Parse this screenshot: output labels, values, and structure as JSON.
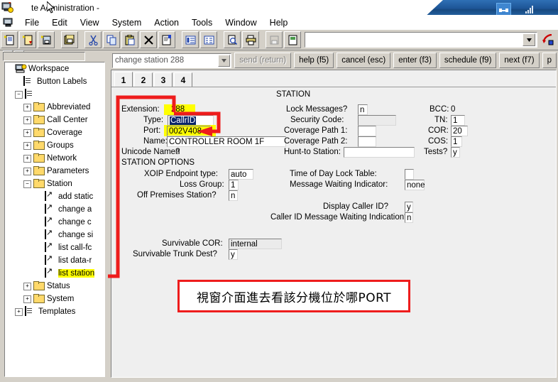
{
  "window": {
    "title": "te Administration -",
    "taskbar_icons": [
      "network-connect-icon",
      "signal-bars-icon"
    ]
  },
  "menubar": {
    "app_icon": "computer-icon",
    "items": [
      "File",
      "Edit",
      "View",
      "System",
      "Action",
      "Tools",
      "Window",
      "Help"
    ]
  },
  "toolbar": {
    "buttons": [
      "new-document-icon",
      "open-document-icon",
      "save-document-icon",
      "save-all-icon",
      "cut-icon",
      "copy-icon",
      "paste-icon",
      "delete-x-icon",
      "properties-icon",
      "list-view-icon",
      "detail-view-icon",
      "print-preview-icon",
      "print-icon",
      "save-disabled-icon",
      "report-icon"
    ],
    "address_value": "",
    "address_dropdown_icon": "chevron-down-icon",
    "go_icon": "go-arrow-icon"
  },
  "sidebar": {
    "scrollbar": "horizontal-scrollbar",
    "close_icon": "close-x-icon",
    "dropdown_icon": "chevron-down-icon",
    "tree": [
      {
        "label": "Workspace",
        "icon": "workspace-icon",
        "depth": 0,
        "toggle": "none",
        "highlight": false
      },
      {
        "label": "Button Labels",
        "icon": "book-icon",
        "depth": 1,
        "toggle": "none",
        "highlight": false
      },
      {
        "label": "",
        "icon": "book-icon",
        "depth": 1,
        "toggle": "minus",
        "highlight": false
      },
      {
        "label": "Abbreviated",
        "icon": "folder-icon",
        "depth": 2,
        "toggle": "plus",
        "highlight": false
      },
      {
        "label": "Call Center",
        "icon": "folder-icon",
        "depth": 2,
        "toggle": "plus",
        "highlight": false
      },
      {
        "label": "Coverage",
        "icon": "folder-icon",
        "depth": 2,
        "toggle": "plus",
        "highlight": false
      },
      {
        "label": "Groups",
        "icon": "folder-icon",
        "depth": 2,
        "toggle": "plus",
        "highlight": false
      },
      {
        "label": "Network",
        "icon": "folder-icon",
        "depth": 2,
        "toggle": "plus",
        "highlight": false
      },
      {
        "label": "Parameters",
        "icon": "folder-icon",
        "depth": 2,
        "toggle": "plus",
        "highlight": false
      },
      {
        "label": "Station",
        "icon": "folder-icon",
        "depth": 2,
        "toggle": "minus",
        "highlight": false
      },
      {
        "label": "add static",
        "icon": "shortcut-icon",
        "depth": 3,
        "toggle": "none",
        "highlight": false
      },
      {
        "label": "change a",
        "icon": "shortcut-icon",
        "depth": 3,
        "toggle": "none",
        "highlight": false
      },
      {
        "label": "change c",
        "icon": "shortcut-icon",
        "depth": 3,
        "toggle": "none",
        "highlight": false
      },
      {
        "label": "change si",
        "icon": "shortcut-icon",
        "depth": 3,
        "toggle": "none",
        "highlight": false
      },
      {
        "label": "list call-fc",
        "icon": "shortcut-icon",
        "depth": 3,
        "toggle": "none",
        "highlight": false
      },
      {
        "label": "list data-r",
        "icon": "shortcut-icon",
        "depth": 3,
        "toggle": "none",
        "highlight": false
      },
      {
        "label": "list station",
        "icon": "shortcut-icon",
        "depth": 3,
        "toggle": "none",
        "highlight": true
      },
      {
        "label": "Status",
        "icon": "folder-icon",
        "depth": 2,
        "toggle": "plus",
        "highlight": false
      },
      {
        "label": "System",
        "icon": "folder-icon",
        "depth": 2,
        "toggle": "plus",
        "highlight": false
      },
      {
        "label": "Templates",
        "icon": "book-icon",
        "depth": 1,
        "toggle": "plus",
        "highlight": false
      }
    ]
  },
  "command_bar": {
    "command_value": "change station 288",
    "dropdown_icon": "chevron-down-icon",
    "buttons": [
      {
        "label": "send (return)",
        "disabled": true
      },
      {
        "label": "help (f5)",
        "disabled": false
      },
      {
        "label": "cancel (esc)",
        "disabled": false
      },
      {
        "label": "enter (f3)",
        "disabled": false
      },
      {
        "label": "schedule (f9)",
        "disabled": false
      },
      {
        "label": "next (f7)",
        "disabled": false
      },
      {
        "label": "p",
        "disabled": false
      }
    ]
  },
  "form": {
    "tabs": [
      "1",
      "2",
      "3",
      "4"
    ],
    "active_tab": "1",
    "title": "STATION",
    "left_fields": [
      {
        "label": "Extension:",
        "value": "288",
        "style": "highlight"
      },
      {
        "label": "Type:",
        "value": "CallrID",
        "style": "selected"
      },
      {
        "label": "Port:",
        "value": "002V408",
        "style": "highlight"
      },
      {
        "label": "Name:",
        "value": "CONTROLLER ROOM 1F",
        "style": "input-wide"
      },
      {
        "label": "Unicode Name?",
        "value": "n",
        "style": "plain"
      }
    ],
    "right_fields": [
      {
        "label": "Lock Messages?",
        "value": "n",
        "style": "input-tiny"
      },
      {
        "label": "Security Code:",
        "value": "",
        "style": "input-gray"
      },
      {
        "label": "Coverage Path 1:",
        "value": "",
        "style": "input-small"
      },
      {
        "label": "Coverage Path 2:",
        "value": "",
        "style": "input-small"
      },
      {
        "label": "Hunt-to Station:",
        "value": "",
        "style": "input-wide2"
      }
    ],
    "far_right_fields": [
      {
        "label": "BCC:",
        "value": "0",
        "style": "plain"
      },
      {
        "label": "TN:",
        "value": "1",
        "style": "input-tiny"
      },
      {
        "label": "COR:",
        "value": "20",
        "style": "input-tiny"
      },
      {
        "label": "COS:",
        "value": "1",
        "style": "input-tiny"
      },
      {
        "label": "Tests?",
        "value": "y",
        "style": "input-tiny"
      }
    ],
    "section_title": "STATION OPTIONS",
    "options_left": [
      {
        "label": "XOIP Endpoint type:",
        "value": "auto"
      },
      {
        "label": "Loss Group:",
        "value": "1"
      },
      {
        "label": "Off Premises Station?",
        "value": "n"
      }
    ],
    "options_right": [
      {
        "label": "Time of Day Lock Table:",
        "value": ""
      },
      {
        "label": "Message Waiting Indicator:",
        "value": "none"
      },
      {
        "label": "Display Caller ID?",
        "value": "y"
      },
      {
        "label": "Caller ID Message Waiting Indication?",
        "value": "n"
      }
    ],
    "survivable": [
      {
        "label": "Survivable COR:",
        "value": "internal"
      },
      {
        "label": "Survivable Trunk Dest?",
        "value": "y"
      }
    ]
  },
  "annotation": {
    "note_text": "視窗介面進去看該分機位於哪PORT",
    "color": "#ee1c1c",
    "highlight_color": "#ffff00"
  }
}
